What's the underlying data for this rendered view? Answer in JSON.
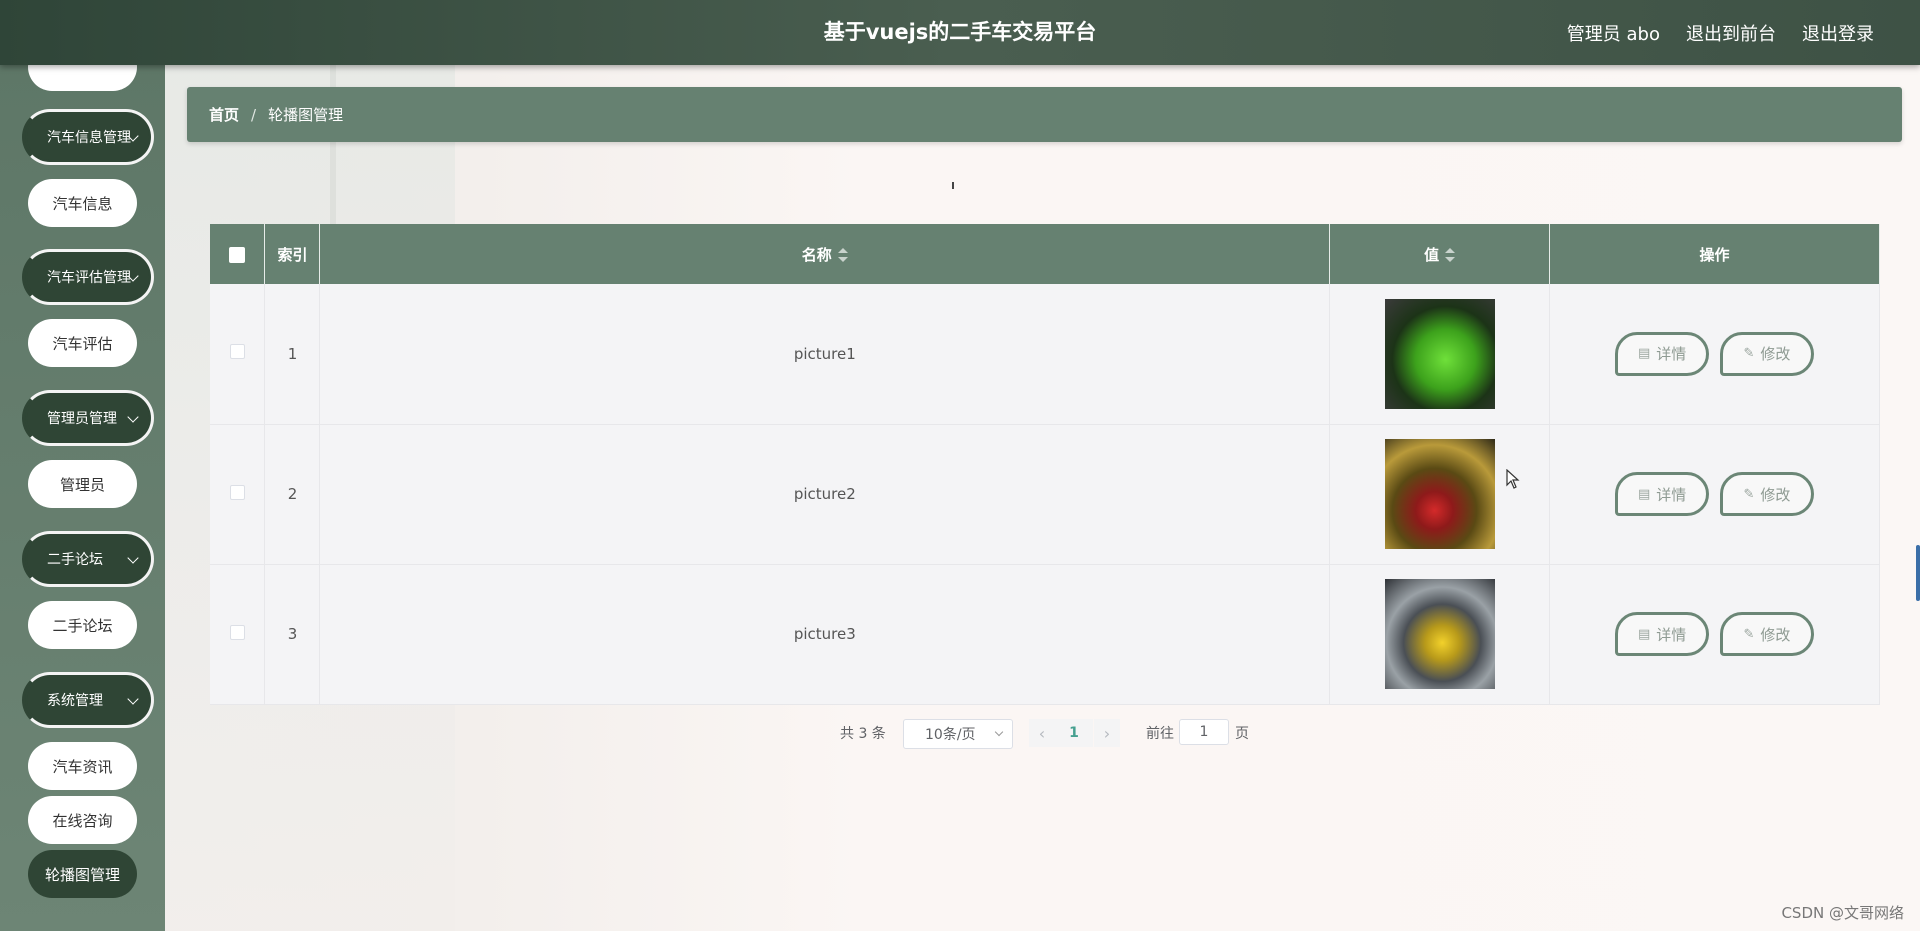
{
  "header": {
    "title": "基于vuejs的二手车交易平台",
    "admin_label": "管理员 abo",
    "to_front": "退出到前台",
    "logout": "退出登录"
  },
  "sidebar": {
    "groups": [
      {
        "label": "汽车信息管理",
        "item": "汽车信息"
      },
      {
        "label": "汽车评估管理",
        "item": "汽车评估"
      },
      {
        "label": "管理员管理",
        "item": "管理员"
      },
      {
        "label": "二手论坛",
        "item": "二手论坛"
      },
      {
        "label": "系统管理",
        "items": [
          "汽车资讯",
          "在线咨询",
          "轮播图管理"
        ]
      }
    ],
    "active_item": "轮播图管理"
  },
  "breadcrumb": {
    "home": "首页",
    "separator": "/",
    "current": "轮播图管理"
  },
  "table": {
    "headers": {
      "index": "索引",
      "name": "名称",
      "value": "值",
      "ops": "操作"
    },
    "rows": [
      {
        "index": "1",
        "name": "picture1",
        "image": "green-car"
      },
      {
        "index": "2",
        "name": "picture2",
        "image": "red-car"
      },
      {
        "index": "3",
        "name": "picture3",
        "image": "yellow-car"
      }
    ],
    "detail_label": "详情",
    "edit_label": "修改"
  },
  "pagination": {
    "total": "共 3 条",
    "page_size": "10条/页",
    "current_page": "1",
    "goto_label": "前往",
    "goto_value": "1",
    "page_unit": "页"
  },
  "watermark": "CSDN @文哥网络",
  "colors": {
    "header": "#3e5245",
    "sidebar": "#668171",
    "accent": "#2f4535",
    "page_active": "#46a090"
  },
  "icons": {
    "detail": "document-icon",
    "edit": "pencil-icon",
    "sort": "sort-caret-icon"
  }
}
